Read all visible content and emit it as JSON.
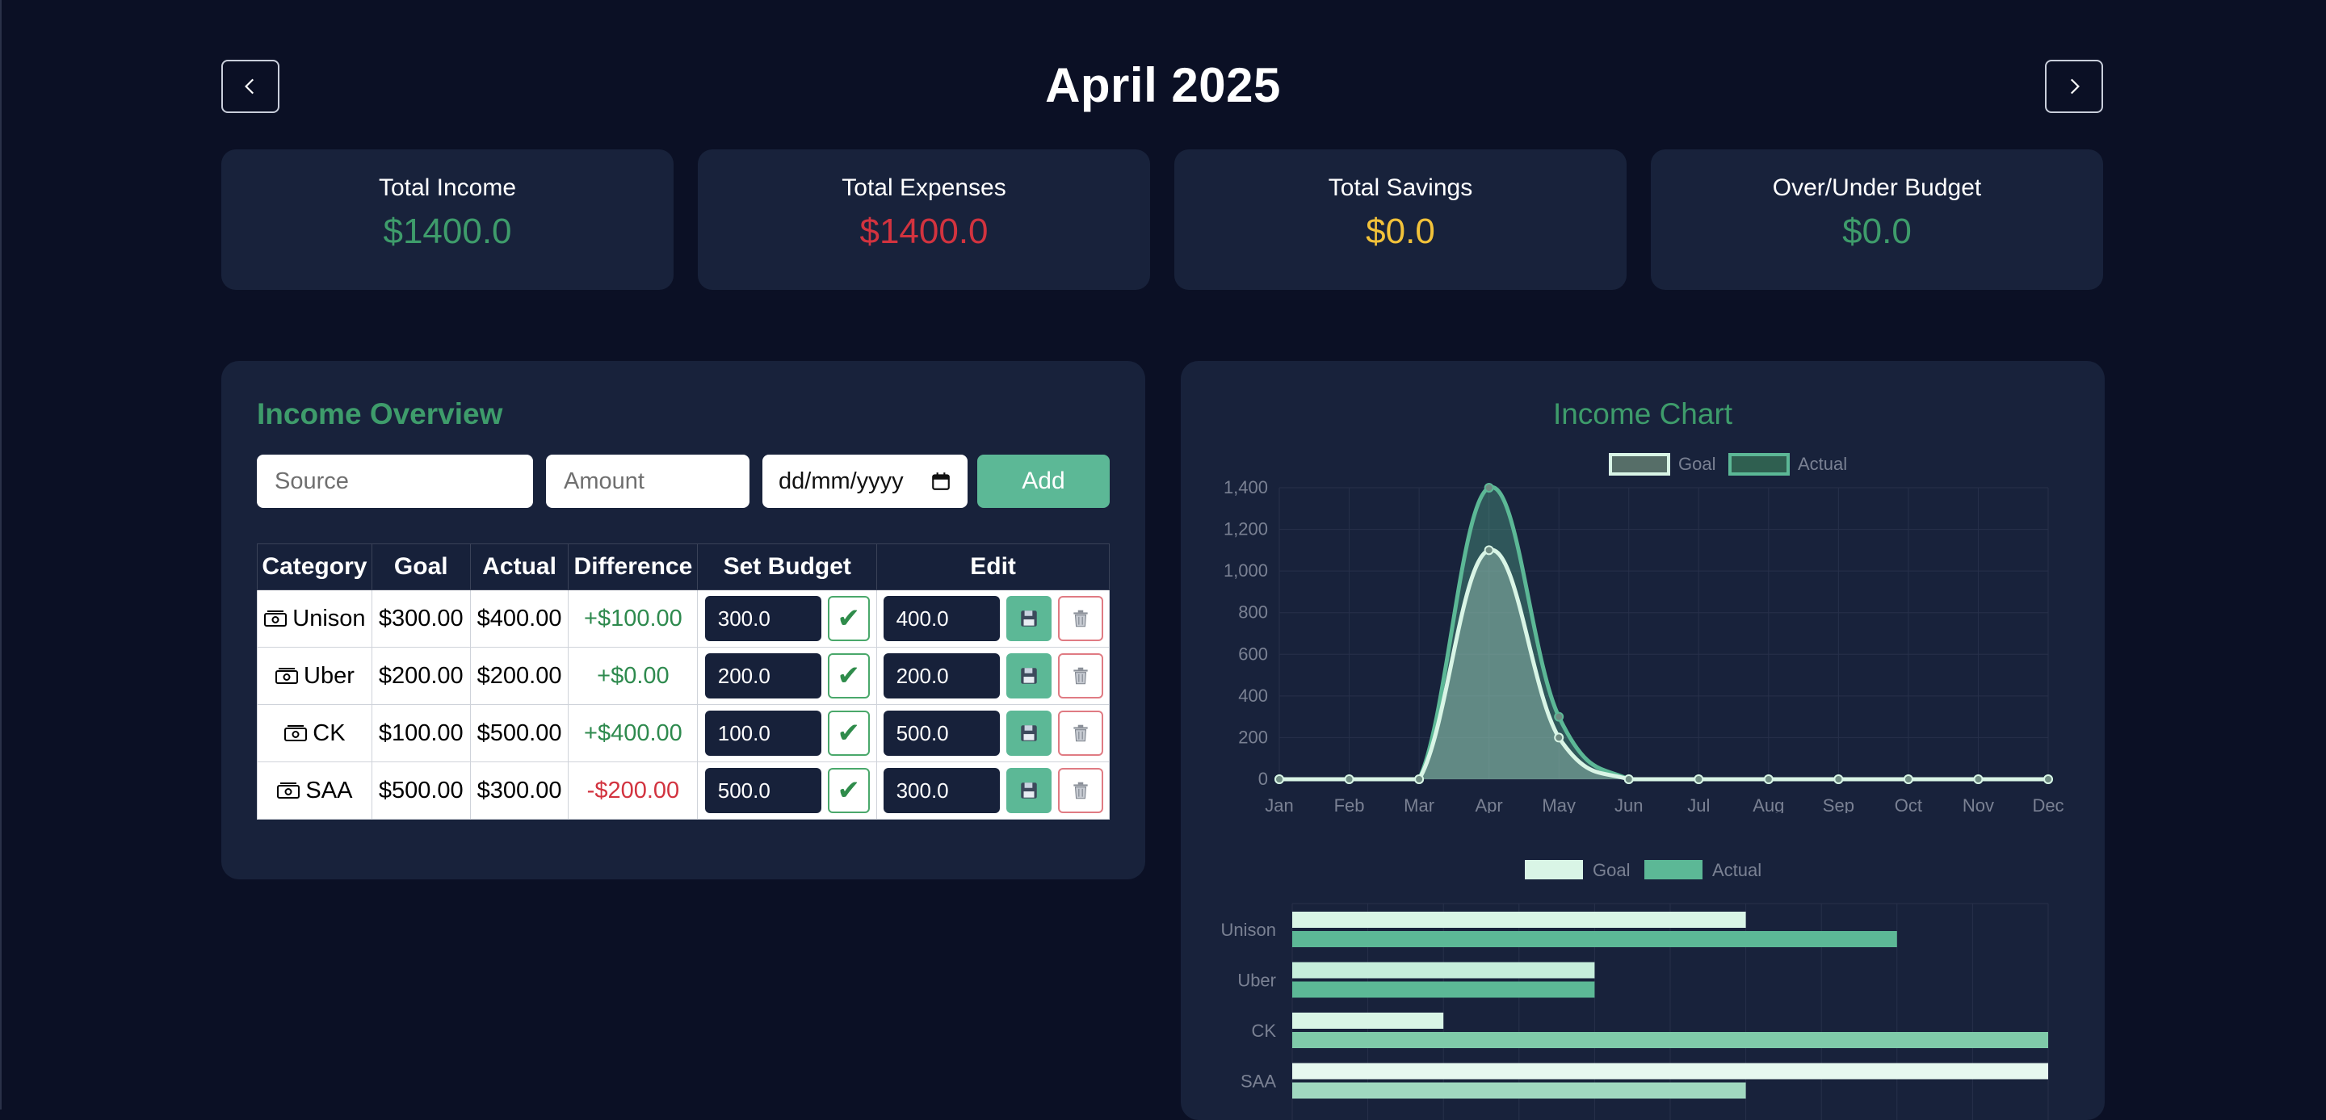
{
  "header": {
    "title": "April 2025",
    "prev_icon": "chevron-left-icon",
    "next_icon": "chevron-right-icon"
  },
  "summary": [
    {
      "label": "Total Income",
      "value": "$1400.0",
      "color": "#3e9c6b"
    },
    {
      "label": "Total Expenses",
      "value": "$1400.0",
      "color": "#d2333f"
    },
    {
      "label": "Total Savings",
      "value": "$0.0",
      "color": "#f2c23a"
    },
    {
      "label": "Over/Under Budget",
      "value": "$0.0",
      "color": "#3e9c6b"
    }
  ],
  "income": {
    "title": "Income Overview",
    "source_placeholder": "Source",
    "amount_placeholder": "Amount",
    "date_placeholder": "dd/mm/yyyy",
    "add_label": "Add",
    "columns": [
      "Category",
      "Goal",
      "Actual",
      "Difference",
      "Set Budget",
      "Edit"
    ],
    "rows": [
      {
        "category": "Unison",
        "goal": "$300.00",
        "actual": "$400.00",
        "difference": "+$100.00",
        "positive": true,
        "budget": "300.0",
        "edit": "400.0"
      },
      {
        "category": "Uber",
        "goal": "$200.00",
        "actual": "$200.00",
        "difference": "+$0.00",
        "positive": true,
        "budget": "200.0",
        "edit": "200.0"
      },
      {
        "category": "CK",
        "goal": "$100.00",
        "actual": "$500.00",
        "difference": "+$400.00",
        "positive": true,
        "budget": "100.0",
        "edit": "500.0"
      },
      {
        "category": "SAA",
        "goal": "$500.00",
        "actual": "$300.00",
        "difference": "-$200.00",
        "positive": false,
        "budget": "500.0",
        "edit": "300.0"
      }
    ],
    "icons": {
      "category": "cash-icon",
      "confirm": "check-icon",
      "save": "floppy-disk-icon",
      "delete": "trash-icon"
    }
  },
  "chart_panel": {
    "title": "Income Chart"
  },
  "chart_data": [
    {
      "type": "area",
      "categories": [
        "Jan",
        "Feb",
        "Mar",
        "Apr",
        "May",
        "Jun",
        "Jul",
        "Aug",
        "Sep",
        "Oct",
        "Nov",
        "Dec"
      ],
      "series": [
        {
          "name": "Goal",
          "values": [
            0,
            0,
            0,
            1100,
            200,
            0,
            0,
            0,
            0,
            0,
            0,
            0
          ],
          "color": "#d9f5e6"
        },
        {
          "name": "Actual",
          "values": [
            0,
            0,
            0,
            1400,
            300,
            0,
            0,
            0,
            0,
            0,
            0,
            0
          ],
          "color": "#5cb896"
        }
      ],
      "ylim": [
        0,
        1400
      ],
      "yticks": [
        "0",
        "200",
        "400",
        "600",
        "800",
        "1,000",
        "1,200",
        "1,400"
      ],
      "legend": "top",
      "grid": true
    },
    {
      "type": "bar",
      "orientation": "horizontal",
      "categories": [
        "Unison",
        "Uber",
        "CK",
        "SAA"
      ],
      "series": [
        {
          "name": "Goal",
          "values": [
            300,
            200,
            100,
            500
          ],
          "color": "#d9f5e6"
        },
        {
          "name": "Actual",
          "values": [
            400,
            200,
            500,
            300
          ],
          "color": "#5cb896"
        }
      ],
      "xlim": [
        0,
        500
      ],
      "legend": "top",
      "grid": true
    }
  ]
}
